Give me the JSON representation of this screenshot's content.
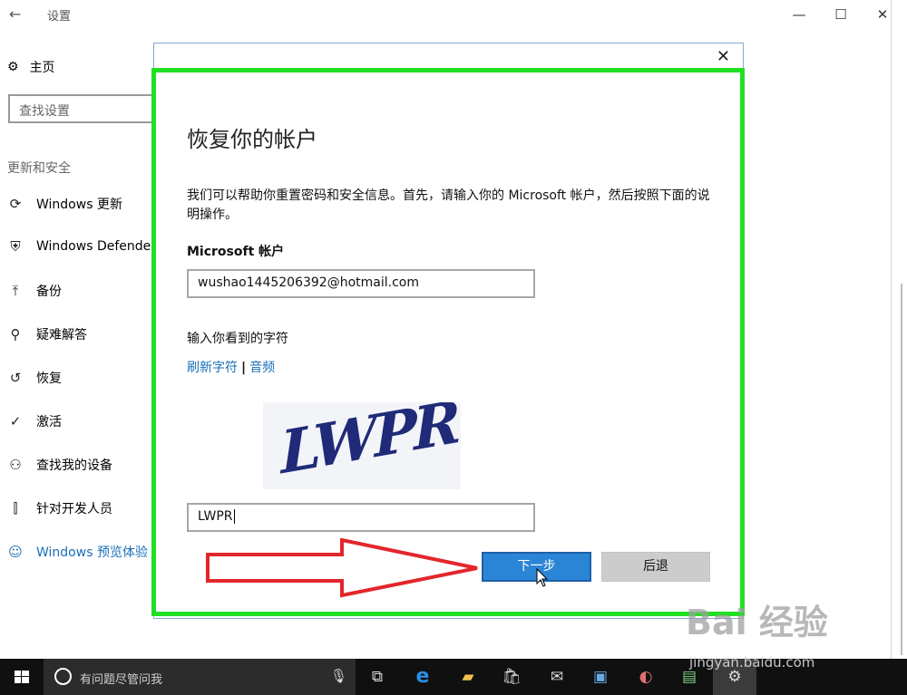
{
  "window": {
    "title": "设置",
    "back_icon": "back-arrow-icon",
    "minimize": "—",
    "maximize": "☐",
    "close": "✕"
  },
  "sidebar": {
    "home_label": "主页",
    "search_placeholder": "查找设置",
    "section_title": "更新和安全",
    "items": [
      {
        "label": "Windows 更新",
        "icon": "refresh-icon"
      },
      {
        "label": "Windows Defender",
        "icon": "shield-icon"
      },
      {
        "label": "备份",
        "icon": "backup-arrow-icon"
      },
      {
        "label": "疑难解答",
        "icon": "wrench-icon"
      },
      {
        "label": "恢复",
        "icon": "history-icon"
      },
      {
        "label": "激活",
        "icon": "check-circle-icon"
      },
      {
        "label": "查找我的设备",
        "icon": "person-locate-icon"
      },
      {
        "label": "针对开发人员",
        "icon": "developer-tools-icon"
      },
      {
        "label": "Windows 预览体验",
        "icon": "cat-icon",
        "active": true
      }
    ]
  },
  "dialog": {
    "close_label": "✕",
    "heading": "恢复你的帐户",
    "description": "我们可以帮助你重置密码和安全信息。首先，请输入你的 Microsoft 帐户，然后按照下面的说明操作。",
    "account_label": "Microsoft 帐户",
    "account_value": "wushao1445206392@hotmail.com",
    "chars_label": "输入你看到的字符",
    "refresh_link": "刷新字符",
    "link_separator": "|",
    "audio_link": "音频",
    "captcha_text": "LWPR",
    "code_value": "LWPR",
    "next_button": "下一步",
    "back_button": "后退"
  },
  "taskbar": {
    "search_placeholder": "有问题尽管问我"
  },
  "watermark": {
    "text": "Bai 经验",
    "url": "jingyan.baidu.com"
  },
  "colors": {
    "accent_blue": "#2b85d6",
    "highlight_green": "#21e023",
    "annotation_red": "#e3262b",
    "link_blue": "#1a6fb7"
  }
}
